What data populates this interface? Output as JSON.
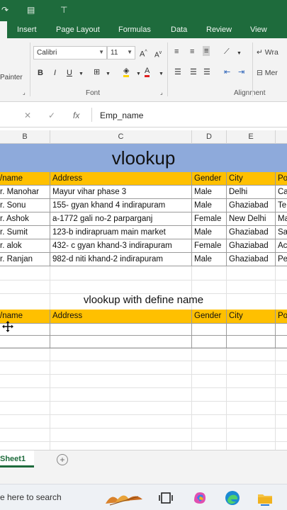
{
  "ribbon": {
    "tabs": [
      "Insert",
      "Page Layout",
      "Formulas",
      "Data",
      "Review",
      "View"
    ],
    "font_name": "Calibri",
    "font_size": "11",
    "painter_label": "Painter",
    "font_group": "Font",
    "alignment_group": "Alignment",
    "wrap_label": "Wra",
    "merge_label": "Mer",
    "bold": "B",
    "italic": "I",
    "underline": "U"
  },
  "formula_bar": {
    "value": "Emp_name"
  },
  "columns": [
    "B",
    "C",
    "D",
    "E"
  ],
  "sheet": {
    "title": "vlookup",
    "table_headers": [
      "/name",
      "Address",
      "Gender",
      "City",
      "Po"
    ],
    "rows": [
      [
        "r. Manohar",
        "Mayur vihar phase 3",
        "Male",
        "Delhi",
        "Ca"
      ],
      [
        "r. Sonu",
        "155- gyan khand 4 indirapuram",
        "Male",
        "Ghaziabad",
        "Te"
      ],
      [
        "r. Ashok",
        "a-1772 gali no-2 parparganj",
        "Female",
        "New Delhi",
        "Ma"
      ],
      [
        "r. Sumit",
        "123-b indirapruam main market",
        "Male",
        "Ghaziabad",
        "Sa"
      ],
      [
        "r. alok",
        "432- c gyan khand-3 indirapuram",
        "Female",
        "Ghaziabad",
        "Ac"
      ],
      [
        "r. Ranjan",
        "982-d niti khand-2 indirapuram",
        "Male",
        "Ghaziabad",
        "Pe"
      ]
    ],
    "subtitle": "vlookup with define name",
    "table2_headers": [
      "/name",
      "Address",
      "Gender",
      "City",
      "Po"
    ]
  },
  "sheet_tabs": {
    "active": "Sheet1"
  },
  "taskbar": {
    "search_text": "e here to search"
  },
  "colors": {
    "excel_green": "#1e6b3c",
    "title_blue": "#8eaadb",
    "header_yellow": "#ffc000"
  }
}
